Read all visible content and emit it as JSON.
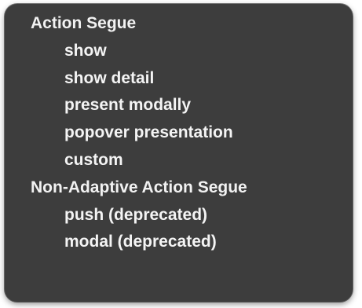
{
  "menu": {
    "sections": [
      {
        "header": "Action Segue",
        "items": [
          "show",
          "show detail",
          "present modally",
          "popover presentation",
          "custom"
        ]
      },
      {
        "header": "Non-Adaptive Action Segue",
        "items": [
          "push (deprecated)",
          "modal (deprecated)"
        ]
      }
    ]
  }
}
